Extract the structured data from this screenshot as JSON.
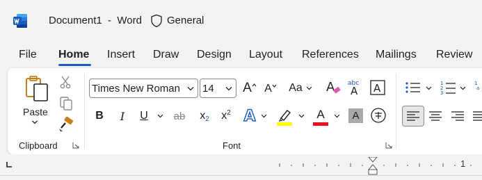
{
  "titlebar": {
    "doc_title": "Document1  -  Word",
    "sensitivity_label": "General",
    "app_icon": "word-icon",
    "sensitivity_icon": "shield-icon"
  },
  "tabs": [
    {
      "label": "File"
    },
    {
      "label": "Home",
      "active": true
    },
    {
      "label": "Insert"
    },
    {
      "label": "Draw"
    },
    {
      "label": "Design"
    },
    {
      "label": "Layout"
    },
    {
      "label": "References"
    },
    {
      "label": "Mailings"
    },
    {
      "label": "Review"
    }
  ],
  "clipboard": {
    "paste_label": "Paste",
    "group_label": "Clipboard",
    "icons": [
      "paste-icon",
      "cut-icon",
      "copy-icon",
      "format-painter-icon"
    ]
  },
  "font": {
    "font_name": "Times New Roman",
    "font_size": "14",
    "group_label": "Font",
    "bold": "B",
    "italic": "I",
    "underline": "U",
    "strikethrough": "ab",
    "subscript": "x",
    "superscript": "x",
    "sub_mark": "2",
    "sup_mark": "2",
    "grow": "A",
    "shrink": "A",
    "change_case": "Aa",
    "phonetic": "abc",
    "text_effects": "A",
    "font_color": "A",
    "highlight_color": "#ffff00",
    "font_color_value": "#e81123"
  },
  "ruler": {
    "marker": "1"
  },
  "colors": {
    "accent": "#185abd",
    "word_blue": "#2b579a"
  }
}
